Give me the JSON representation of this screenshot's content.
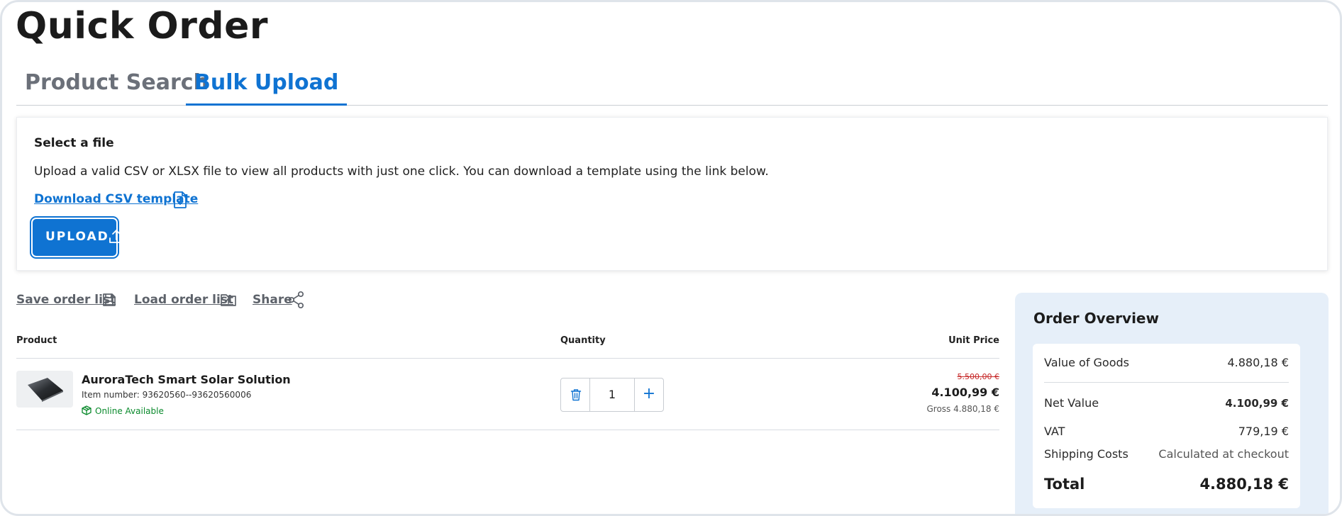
{
  "page": {
    "title": "Quick Order"
  },
  "tabs": [
    {
      "label": "Product Search",
      "active": false
    },
    {
      "label": "Bulk Upload",
      "active": true
    }
  ],
  "upload": {
    "title": "Select a file",
    "description": "Upload a valid CSV or XLSX file to view all products with just one click. You can download a template using the link below.",
    "download_link": "Download CSV template",
    "upload_button": "UPLOAD"
  },
  "actions": {
    "save": "Save order list",
    "load": "Load order list",
    "share": "Share"
  },
  "table": {
    "headers": {
      "product": "Product",
      "quantity": "Quantity",
      "unit_price": "Unit Price"
    },
    "rows": [
      {
        "name": "AuroraTech Smart Solar Solution",
        "item_number": "Item number: 93620560--93620560006",
        "availability": "Online Available",
        "quantity": "1",
        "price_old": "5.500,00 €",
        "price_new": "4.100,99 €",
        "price_gross": "Gross 4.880,18 €"
      }
    ]
  },
  "overview": {
    "title": "Order Overview",
    "value_of_goods_label": "Value of Goods",
    "value_of_goods": "4.880,18 €",
    "net_value_label": "Net Value",
    "net_value": "4.100,99 €",
    "vat_label": "VAT",
    "vat": "779,19 €",
    "shipping_label": "Shipping Costs",
    "shipping": "Calculated at checkout",
    "total_label": "Total",
    "total": "4.880,18 €"
  },
  "colors": {
    "accent": "#0f73d2",
    "available": "#0a8a2c",
    "strike_price": "#c62828",
    "overview_bg": "#e6eff9"
  }
}
